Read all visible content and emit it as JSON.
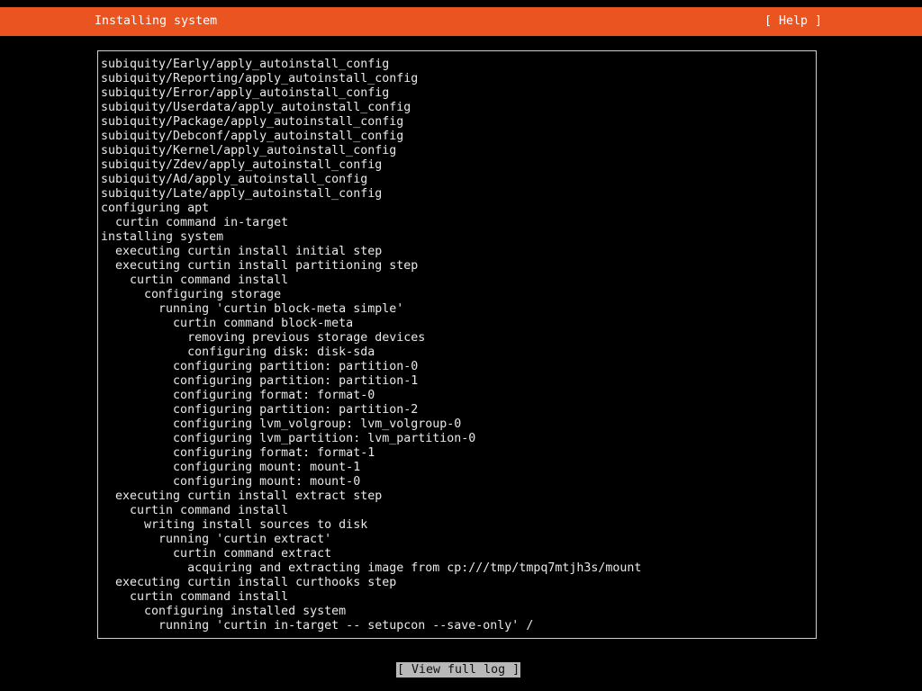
{
  "header": {
    "title": "Installing system",
    "help_label": "[ Help ]"
  },
  "log": {
    "lines": [
      "subiquity/Early/apply_autoinstall_config",
      "subiquity/Reporting/apply_autoinstall_config",
      "subiquity/Error/apply_autoinstall_config",
      "subiquity/Userdata/apply_autoinstall_config",
      "subiquity/Package/apply_autoinstall_config",
      "subiquity/Debconf/apply_autoinstall_config",
      "subiquity/Kernel/apply_autoinstall_config",
      "subiquity/Zdev/apply_autoinstall_config",
      "subiquity/Ad/apply_autoinstall_config",
      "subiquity/Late/apply_autoinstall_config",
      "configuring apt",
      "  curtin command in-target",
      "installing system",
      "  executing curtin install initial step",
      "  executing curtin install partitioning step",
      "    curtin command install",
      "      configuring storage",
      "        running 'curtin block-meta simple'",
      "          curtin command block-meta",
      "            removing previous storage devices",
      "            configuring disk: disk-sda",
      "          configuring partition: partition-0",
      "          configuring partition: partition-1",
      "          configuring format: format-0",
      "          configuring partition: partition-2",
      "          configuring lvm_volgroup: lvm_volgroup-0",
      "          configuring lvm_partition: lvm_partition-0",
      "          configuring format: format-1",
      "          configuring mount: mount-1",
      "          configuring mount: mount-0",
      "  executing curtin install extract step",
      "    curtin command install",
      "      writing install sources to disk",
      "        running 'curtin extract'",
      "          curtin command extract",
      "            acquiring and extracting image from cp:///tmp/tmpq7mtjh3s/mount",
      "  executing curtin install curthooks step",
      "    curtin command install",
      "      configuring installed system",
      "        running 'curtin in-target -- setupcon --save-only' /"
    ]
  },
  "footer": {
    "view_log_label": "[ View full log ]"
  },
  "colors": {
    "header_bg": "#e95420",
    "background": "#000000",
    "text": "#e8e8e8",
    "button_bg": "#b8b8b8"
  }
}
